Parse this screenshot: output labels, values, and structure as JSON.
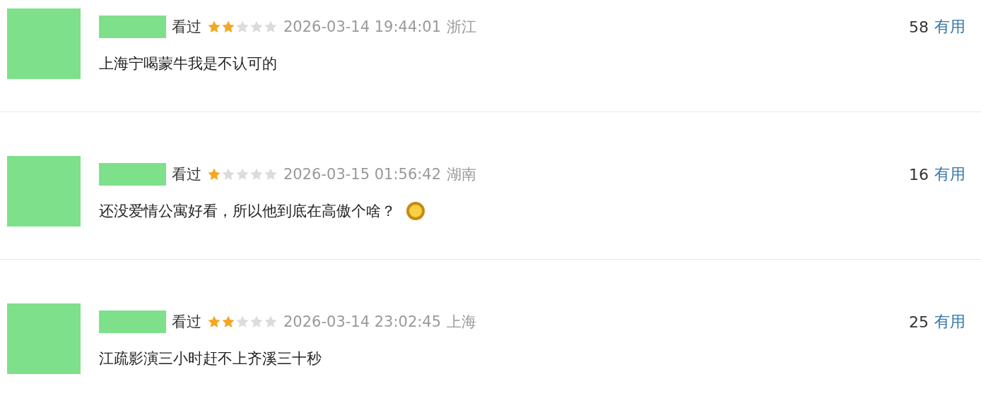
{
  "comments": [
    {
      "status": "看过",
      "stars": 2,
      "time": "2026-03-14 19:44:01",
      "location": "浙江",
      "text": "上海宁喝蒙牛我是不认可的",
      "emoji": false,
      "votes": "58",
      "votes_label": "有用"
    },
    {
      "status": "看过",
      "stars": 1,
      "time": "2026-03-15 01:56:42",
      "location": "湖南",
      "text": "还没爱情公寓好看，所以他到底在高傲个啥？",
      "emoji": true,
      "votes": "16",
      "votes_label": "有用"
    },
    {
      "status": "看过",
      "stars": 2,
      "time": "2026-03-14 23:02:45",
      "location": "上海",
      "text": "江疏影演三小时赶不上齐溪三十秒",
      "emoji": false,
      "votes": "25",
      "votes_label": "有用"
    }
  ]
}
